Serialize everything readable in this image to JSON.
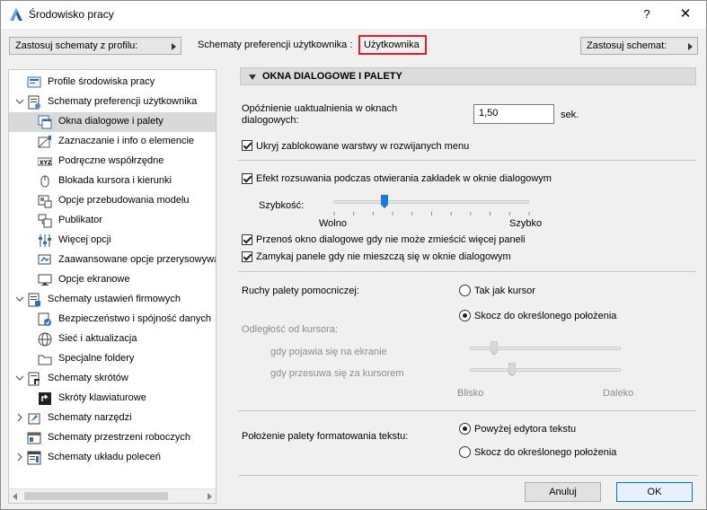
{
  "window": {
    "title": "Środowisko pracy",
    "help": "?",
    "close": "✕"
  },
  "top": {
    "apply_profile_btn": "Zastosuj schematy z profilu:",
    "prefs_label": "Schematy preferencji użytkownika :",
    "prefs_value": "Użytkownika",
    "apply_scheme_btn": "Zastosuj schemat:"
  },
  "tree": [
    {
      "label": "Profile środowiska pracy",
      "level": 0,
      "expander": "",
      "icon": "profile-icon"
    },
    {
      "label": "Schematy preferencji użytkownika",
      "level": 0,
      "expander": "v",
      "icon": "user-prefs-icon"
    },
    {
      "label": "Okna dialogowe i palety",
      "level": 1,
      "expander": "",
      "icon": "dialogs-icon",
      "selected": true
    },
    {
      "label": "Zaznaczanie i info o elemencie",
      "level": 1,
      "expander": "",
      "icon": "selection-info-icon"
    },
    {
      "label": "Podręczne współrzędne",
      "level": 1,
      "expander": "",
      "icon": "xyz-icon"
    },
    {
      "label": "Blokada kursora i kierunki",
      "level": 1,
      "expander": "",
      "icon": "mouse-icon"
    },
    {
      "label": "Opcje przebudowania modelu",
      "level": 1,
      "expander": "",
      "icon": "rebuild-icon"
    },
    {
      "label": "Publikator",
      "level": 1,
      "expander": "",
      "icon": "publisher-icon"
    },
    {
      "label": "Więcej opcji",
      "level": 1,
      "expander": "",
      "icon": "sliders-icon"
    },
    {
      "label": "Zaawansowane opcje przerysowywania",
      "level": 1,
      "expander": "",
      "icon": "redraw-icon"
    },
    {
      "label": "Opcje ekranowe",
      "level": 1,
      "expander": "",
      "icon": "screen-icon"
    },
    {
      "label": "Schematy ustawień firmowych",
      "level": 0,
      "expander": "v",
      "icon": "company-icon"
    },
    {
      "label": "Bezpieczeństwo i spójność danych",
      "level": 1,
      "expander": "",
      "icon": "security-icon"
    },
    {
      "label": "Sieć i aktualizacja",
      "level": 1,
      "expander": "",
      "icon": "network-icon"
    },
    {
      "label": "Specjalne foldery",
      "level": 1,
      "expander": "",
      "icon": "folder-icon"
    },
    {
      "label": "Schematy skrótów",
      "level": 0,
      "expander": "v",
      "icon": "shortcuts-icon"
    },
    {
      "label": "Skróty klawiaturowe",
      "level": 1,
      "expander": "",
      "icon": "keyboard-icon"
    },
    {
      "label": "Schematy narzędzi",
      "level": 0,
      "expander": ">",
      "icon": "tools-icon"
    },
    {
      "label": "Schematy przestrzeni roboczych",
      "level": 0,
      "expander": "",
      "icon": "workspace-icon"
    },
    {
      "label": "Schematy układu poleceń",
      "level": 0,
      "expander": ">",
      "icon": "commands-icon"
    }
  ],
  "panel": {
    "header": "OKNA DIALOGOWE I PALETY",
    "delay_label_1": "Opóźnienie uaktualnienia w oknach",
    "delay_label_2": "dialogowych:",
    "delay_value": "1,50",
    "delay_unit": "sek.",
    "hide_locked": "Ukryj zablokowane warstwy w rozwijanych menu",
    "scroll_effect": "Efekt rozsuwania podczas otwierania zakładek w oknie dialogowym",
    "speed_label": "Szybkość:",
    "speed_slow": "Wolno",
    "speed_fast": "Szybko",
    "speed_level": 0.26,
    "move_dialog": "Przenoś okno dialogowe gdy nie może zmieścić więcej paneli",
    "close_panels": "Zamykaj panele gdy nie mieszczą się w oknie dialogowym",
    "palette_moves_label": "Ruchy palety pomocniczej:",
    "palette_opt1": "Tak jak kursor",
    "palette_opt2": "Skocz do określonego położenia",
    "distance_label": "Odległość od kursora:",
    "on_appear": "gdy pojawia się na ekranie",
    "on_move": "gdy przesuwa się za kursorem",
    "near": "Blisko",
    "far": "Daleko",
    "appear_level": 0.16,
    "move_level": 0.28,
    "text_palette_label": "Położenie palety formatowania tekstu:",
    "text_opt1": "Powyżej edytora tekstu",
    "text_opt2": "Skocz do określonego położenia"
  },
  "footer": {
    "cancel": "Anuluj",
    "ok": "OK"
  }
}
